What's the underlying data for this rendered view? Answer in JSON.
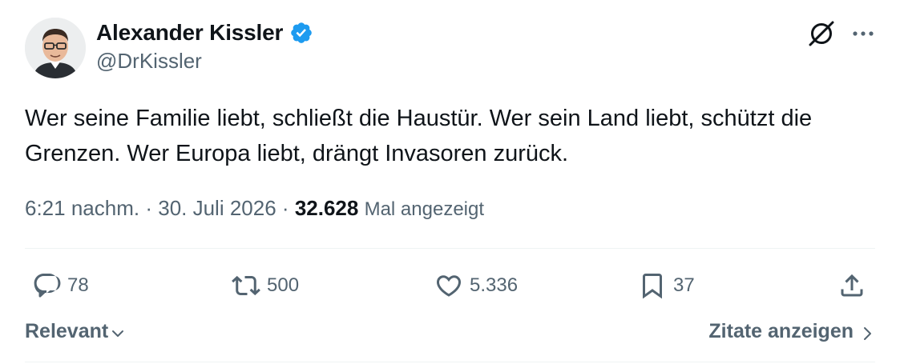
{
  "author": {
    "name": "Alexander Kissler",
    "handle": "@DrKissler",
    "verified_color": "#1d9bf0"
  },
  "tweet": {
    "text": "Wer seine Familie liebt, schließt die Haustür. Wer sein Land liebt, schützt die Grenzen. Wer Europa liebt, drängt Invasoren zurück.",
    "time": "6:21 nachm.",
    "separator": "·",
    "date": "30. Juli 2026",
    "views": "32.628",
    "views_label": "Mal angezeigt"
  },
  "actions": {
    "replies": "78",
    "reposts": "500",
    "likes": "5.336",
    "bookmarks": "37"
  },
  "footer": {
    "sort_label": "Relevant",
    "quotes_label": "Zitate anzeigen"
  },
  "icons": {
    "grok": "grok-icon",
    "more": "more-icon",
    "reply": "reply-icon",
    "repost": "repost-icon",
    "like": "like-icon",
    "bookmark": "bookmark-icon",
    "share": "share-icon"
  },
  "colors": {
    "text": "#0f1419",
    "secondary": "#536471",
    "divider": "#eff3f4"
  }
}
